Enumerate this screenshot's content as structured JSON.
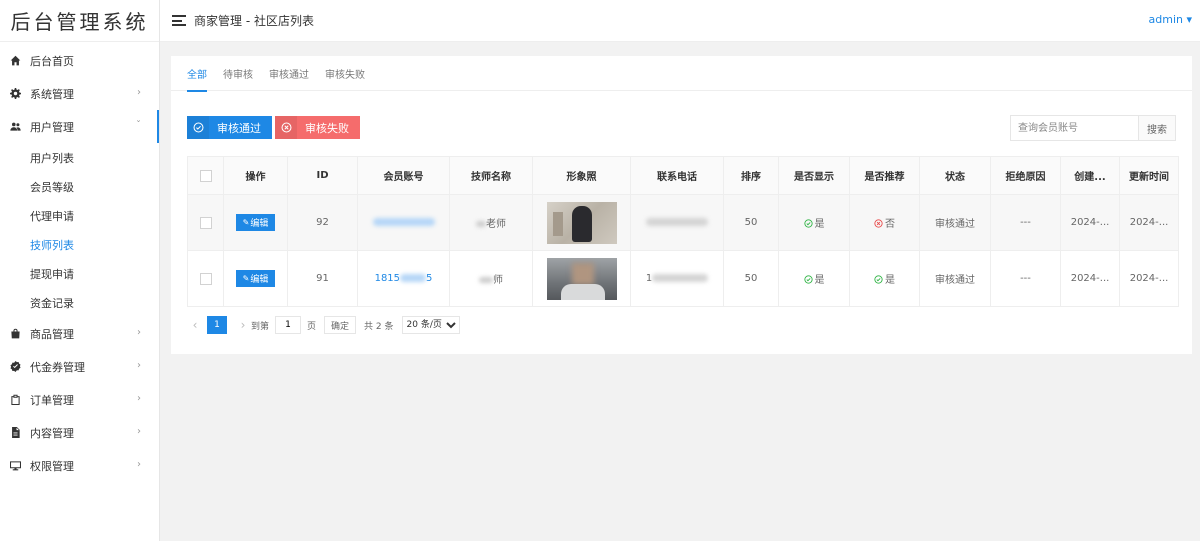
{
  "app": {
    "logo": "后台管理系统",
    "breadcrumb": "商家管理 - 社区店列表",
    "user": "admin"
  },
  "sidebar": {
    "items": [
      {
        "label": "后台首页",
        "icon": "home-icon"
      },
      {
        "label": "系统管理",
        "icon": "gear-icon",
        "arrow": "›"
      },
      {
        "label": "用户管理",
        "icon": "users-icon",
        "arrow": "ˇ"
      },
      {
        "label": "商品管理",
        "icon": "bag-icon",
        "arrow": "›"
      },
      {
        "label": "代金券管理",
        "icon": "badge-check-icon",
        "arrow": "›"
      },
      {
        "label": "订单管理",
        "icon": "clipboard-icon",
        "arrow": "›"
      },
      {
        "label": "内容管理",
        "icon": "document-icon",
        "arrow": "›"
      },
      {
        "label": "权限管理",
        "icon": "monitor-icon",
        "arrow": "›"
      }
    ],
    "user_sub": [
      "用户列表",
      "会员等级",
      "代理申请",
      "技师列表",
      "提现申请",
      "资金记录"
    ]
  },
  "tabs": [
    "全部",
    "待审核",
    "审核通过",
    "审核失败"
  ],
  "toolbar": {
    "pass_label": "审核通过",
    "fail_label": "审核失败",
    "search_placeholder": "查询会员账号",
    "search_label": "搜索"
  },
  "table": {
    "headers": [
      "",
      "操作",
      "ID",
      "会员账号",
      "技师名称",
      "形象照",
      "联系电话",
      "排序",
      "是否显示",
      "是否推荐",
      "状态",
      "拒绝原因",
      "创建...",
      "更新时间"
    ],
    "edit_label": "编辑",
    "rows": [
      {
        "id": "92",
        "account": "",
        "tech_name": "老师",
        "phone": "",
        "sort": "50",
        "show": "是",
        "recommend": "否",
        "status": "审核通过",
        "reject": "---",
        "created": "2024-...",
        "updated": "2024-..."
      },
      {
        "id": "91",
        "account": "1815",
        "account_tail": "5",
        "tech_name": "师",
        "phone": "1",
        "sort": "50",
        "show": "是",
        "recommend": "是",
        "status": "审核通过",
        "reject": "---",
        "created": "2024-...",
        "updated": "2024-..."
      }
    ]
  },
  "pager": {
    "current": "1",
    "goto_label": "到第",
    "goto_value": "1",
    "page_unit": "页",
    "confirm": "确定",
    "total": "共 2 条",
    "page_size": "20 条/页"
  }
}
